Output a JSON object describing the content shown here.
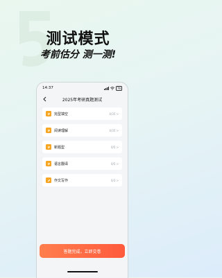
{
  "promo": {
    "headline": "测试模式",
    "subline": "考前估分 测一测!"
  },
  "status_bar": {
    "time": "14:37",
    "battery": "76"
  },
  "nav": {
    "title": "2025年考研真题测试"
  },
  "sections": [
    {
      "label": "完型填空",
      "count": "4/35 >"
    },
    {
      "label": "阅读理解",
      "count": "4/35 >"
    },
    {
      "label": "新题型",
      "count": "0/5 >"
    },
    {
      "label": "语言翻译",
      "count": "0/5 >"
    },
    {
      "label": "作文写作",
      "count": "0/3 >"
    }
  ],
  "actions": {
    "submit_label": "答题完成，立即交卷"
  },
  "colors": {
    "accent": "#ff5a3c",
    "icon_orange": "#f6a623"
  }
}
